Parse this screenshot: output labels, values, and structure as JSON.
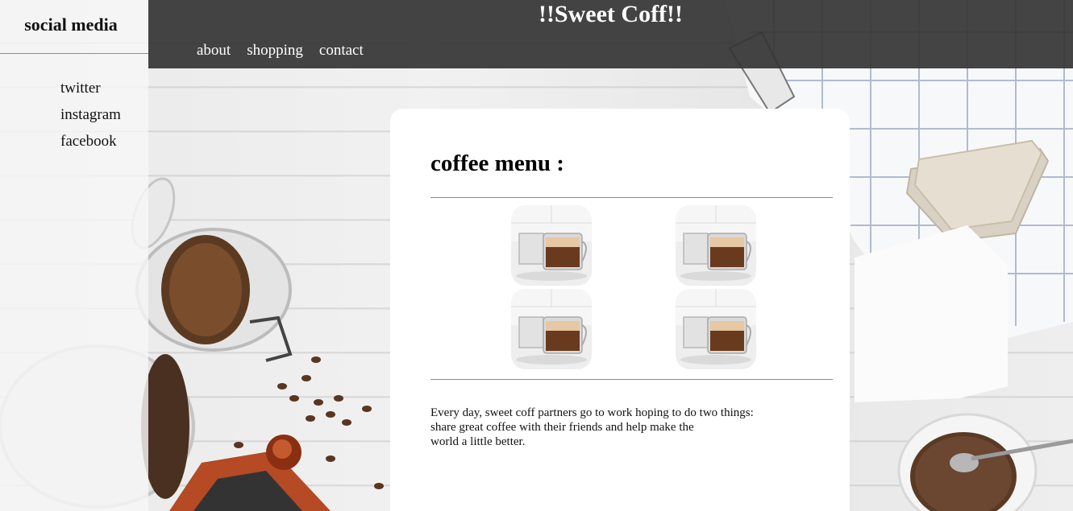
{
  "sidebar": {
    "title": "social media",
    "links": [
      {
        "label": "twitter"
      },
      {
        "label": "instagram"
      },
      {
        "label": "facebook"
      }
    ]
  },
  "header": {
    "title": "!!Sweet Coff!!",
    "nav": [
      {
        "label": "about"
      },
      {
        "label": "shopping"
      },
      {
        "label": "contact"
      }
    ]
  },
  "main": {
    "heading": "coffee menu :",
    "menu_items": [
      {
        "icon": "coffee-cup-image"
      },
      {
        "icon": "coffee-cup-image"
      },
      {
        "icon": "coffee-cup-image"
      },
      {
        "icon": "coffee-cup-image"
      }
    ],
    "description_lines": [
      "Every day, sweet coff partners go to work hoping to do two things:",
      "share great coffee with their friends and help make the",
      "world a little better."
    ]
  },
  "colors": {
    "header_bg": "#343434",
    "sidebar_bg": "#f6f6f6",
    "card_bg": "#ffffff"
  }
}
